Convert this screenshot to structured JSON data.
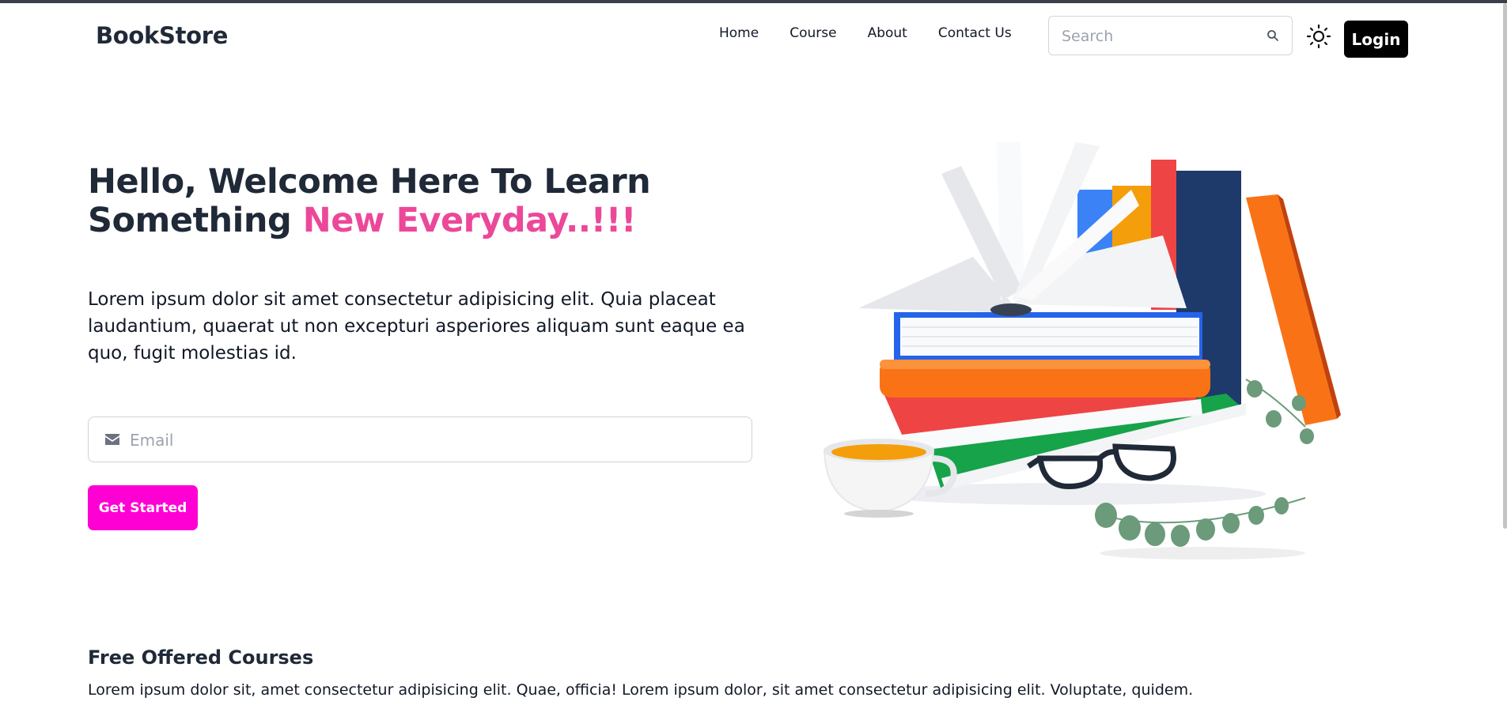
{
  "navbar": {
    "brand": "BookStore",
    "links": [
      "Home",
      "Course",
      "About",
      "Contact Us"
    ],
    "search_placeholder": "Search",
    "search_icon": "search-icon",
    "theme_icon": "sun-icon",
    "login_label": "Login"
  },
  "hero": {
    "title_line1": "Hello, Welcome Here To Learn",
    "title_line2_plain": "Something ",
    "title_line2_accent": "New Everyday..!!!",
    "description": "Lorem ipsum dolor sit amet consectetur adipisicing elit. Quia placeat laudantium, quaerat ut non excepturi asperiores aliquam sunt eaque ea quo, fugit molestias id.",
    "email_placeholder": "Email",
    "email_icon": "envelope-icon",
    "cta_label": "Get Started",
    "illustration": "books-stack-illustration"
  },
  "courses": {
    "title": "Free Offered Courses",
    "description": "Lorem ipsum dolor sit, amet consectetur adipisicing elit. Quae, officia! Lorem ipsum dolor, sit amet consectetur adipisicing elit. Voluptate, quidem."
  },
  "colors": {
    "accent_pink": "#ec4899",
    "cta_magenta": "#ff00d4",
    "login_bg": "#000000",
    "text_dark": "#1f2937"
  }
}
